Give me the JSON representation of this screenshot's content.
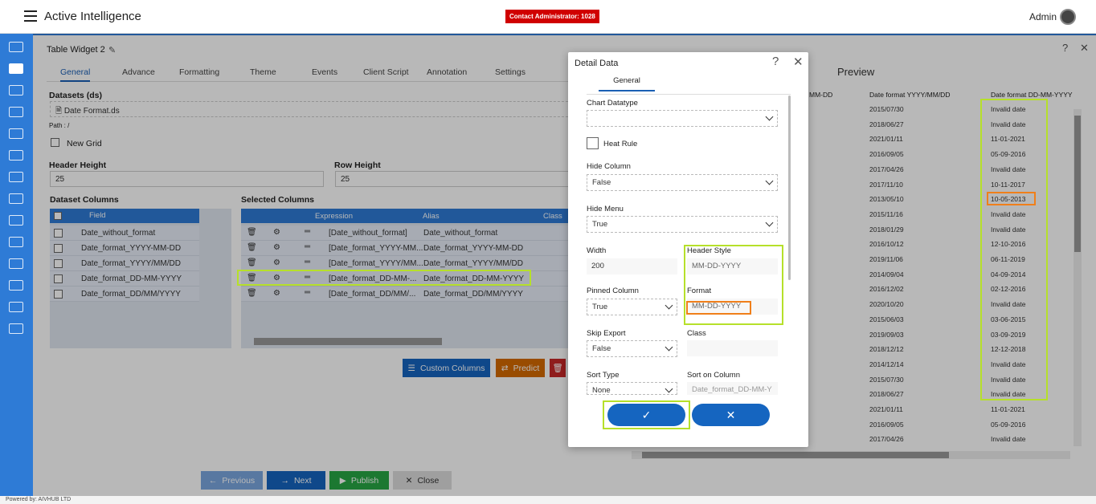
{
  "app": {
    "title": "Active Intelligence",
    "contact": "Contact Administrator: 1028",
    "user": "Admin",
    "powered_by": "Powered by: AIVHUB LTD"
  },
  "widget": {
    "title": "Table Widget 2",
    "tabs": [
      "General",
      "Advance",
      "Formatting",
      "Theme",
      "Events",
      "Client Script",
      "Annotation",
      "Settings"
    ],
    "datasets_label": "Datasets (ds)",
    "dataset_name": "Date Format.ds",
    "path": "Path : /",
    "new_grid": "New Grid",
    "header_height_label": "Header Height",
    "header_height_value": "25",
    "row_height_label": "Row Height",
    "row_height_value": "25",
    "dataset_columns_label": "Dataset Columns",
    "selected_columns_label": "Selected Columns",
    "dataset_columns_header": "Field",
    "dataset_columns": [
      "Date_without_format",
      "Date_format_YYYY-MM-DD",
      "Date_format_YYYY/MM/DD",
      "Date_format_DD-MM-YYYY",
      "Date_format_DD/MM/YYYY"
    ],
    "selected_headers": {
      "expression": "Expression",
      "alias": "Alias",
      "class": "Class"
    },
    "selected_rows": [
      {
        "expression": "[Date_without_format]",
        "alias": "Date_without_format"
      },
      {
        "expression": "[Date_format_YYYY-MM...",
        "alias": "Date_format_YYYY-MM-DD"
      },
      {
        "expression": "[Date_format_YYYY/MM...",
        "alias": "Date_format_YYYY/MM/DD"
      },
      {
        "expression": "[Date_format_DD-MM-...",
        "alias": "Date_format_DD-MM-YYYY"
      },
      {
        "expression": "[Date_format_DD/MM/...",
        "alias": "Date_format_DD/MM/YYYY"
      }
    ],
    "buttons": {
      "custom_columns": "Custom Columns",
      "predict": "Predict"
    },
    "footer": {
      "previous": "Previous",
      "next": "Next",
      "publish": "Publish",
      "close": "Close"
    }
  },
  "preview": {
    "title": "Preview",
    "headers": [
      "MM-DD",
      "Date format YYYY/MM/DD",
      "Date format DD-MM-YYYY"
    ],
    "col_yyyy": [
      "2015/07/30",
      "2018/06/27",
      "2021/01/11",
      "2016/09/05",
      "2017/04/26",
      "2017/11/10",
      "2013/05/10",
      "2015/11/16",
      "2018/01/29",
      "2016/10/12",
      "2019/11/06",
      "2014/09/04",
      "2016/12/02",
      "2020/10/20",
      "2015/06/03",
      "2019/09/03",
      "2018/12/12",
      "2014/12/14",
      "2015/07/30",
      "2018/06/27",
      "2021/01/11",
      "2016/09/05",
      "2017/04/26"
    ],
    "col_dd": [
      "Invalid date",
      "Invalid date",
      "11-01-2021",
      "05-09-2016",
      "Invalid date",
      "10-11-2017",
      "10-05-2013",
      "Invalid date",
      "Invalid date",
      "12-10-2016",
      "06-11-2019",
      "04-09-2014",
      "02-12-2016",
      "Invalid date",
      "03-06-2015",
      "03-09-2019",
      "12-12-2018",
      "Invalid date",
      "Invalid date",
      "Invalid date",
      "11-01-2021",
      "05-09-2016",
      "Invalid date"
    ]
  },
  "modal": {
    "title": "Detail Data",
    "tab": "General",
    "chart_datatype_label": "Chart Datatype",
    "chart_datatype_value": "",
    "heat_rule_label": "Heat Rule",
    "hide_column_label": "Hide Column",
    "hide_column_value": "False",
    "hide_menu_label": "Hide Menu",
    "hide_menu_value": "True",
    "width_label": "Width",
    "width_value": "200",
    "header_style_label": "Header Style",
    "header_style_value": "MM-DD-YYYY",
    "pinned_column_label": "Pinned Column",
    "pinned_column_value": "True",
    "format_label": "Format",
    "format_value": "MM-DD-YYYY",
    "skip_export_label": "Skip Export",
    "skip_export_value": "False",
    "class_label": "Class",
    "class_value": "",
    "sort_type_label": "Sort Type",
    "sort_type_value": "None",
    "sort_on_column_label": "Sort on Column",
    "sort_on_column_value": "Date_format_DD-MM-Y"
  }
}
